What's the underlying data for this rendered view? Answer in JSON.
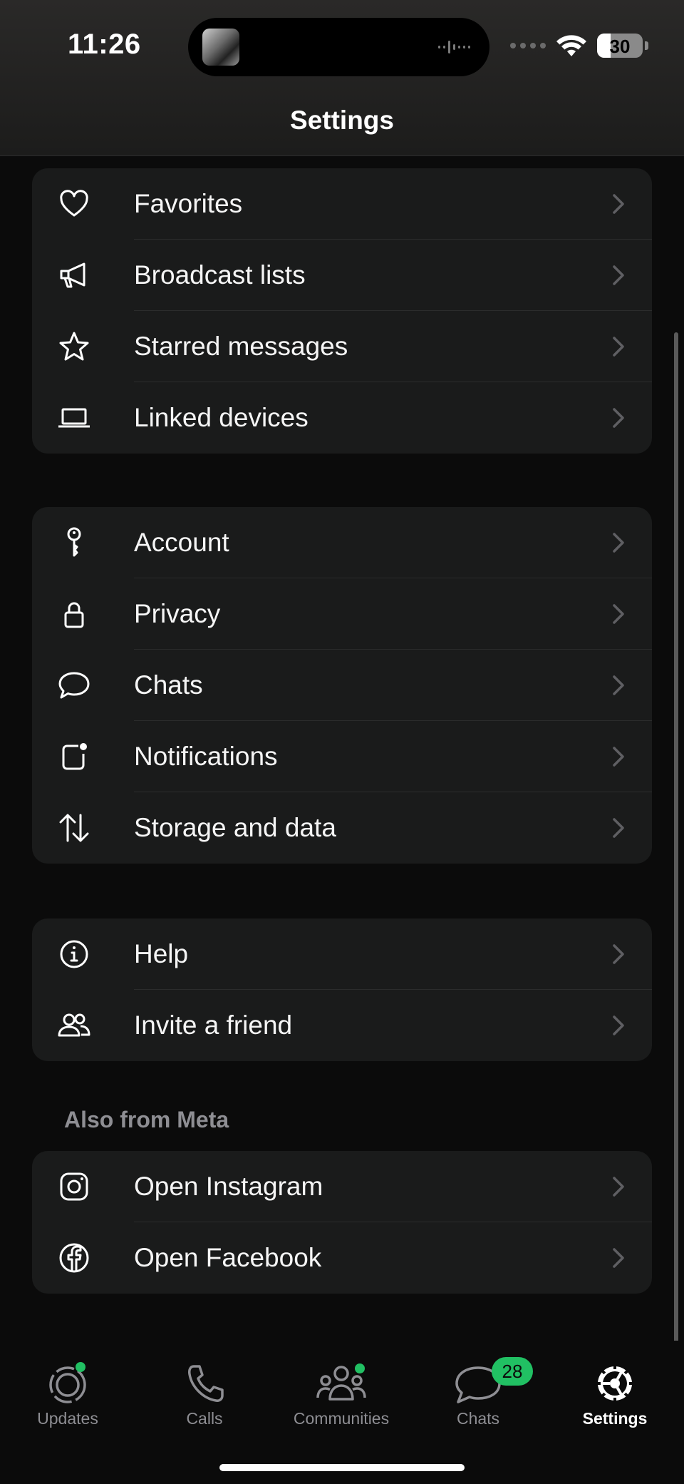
{
  "status_bar": {
    "time": "11:26",
    "battery_level": "30"
  },
  "header": {
    "title": "Settings"
  },
  "groups": [
    {
      "items": [
        {
          "label": "Favorites",
          "icon": "heart-icon"
        },
        {
          "label": "Broadcast lists",
          "icon": "megaphone-icon"
        },
        {
          "label": "Starred messages",
          "icon": "star-icon"
        },
        {
          "label": "Linked devices",
          "icon": "laptop-icon"
        }
      ]
    },
    {
      "items": [
        {
          "label": "Account",
          "icon": "key-icon"
        },
        {
          "label": "Privacy",
          "icon": "lock-icon"
        },
        {
          "label": "Chats",
          "icon": "chat-bubble-icon"
        },
        {
          "label": "Notifications",
          "icon": "notification-icon"
        },
        {
          "label": "Storage and data",
          "icon": "storage-arrows-icon"
        }
      ]
    },
    {
      "items": [
        {
          "label": "Help",
          "icon": "info-icon"
        },
        {
          "label": "Invite a friend",
          "icon": "people-icon"
        }
      ]
    },
    {
      "section_label": "Also from Meta",
      "items": [
        {
          "label": "Open Instagram",
          "icon": "instagram-icon"
        },
        {
          "label": "Open Facebook",
          "icon": "facebook-icon"
        }
      ]
    }
  ],
  "tabbar": {
    "tabs": [
      {
        "label": "Updates",
        "icon": "updates-icon"
      },
      {
        "label": "Calls",
        "icon": "phone-icon"
      },
      {
        "label": "Communities",
        "icon": "communities-icon"
      },
      {
        "label": "Chats",
        "icon": "chats-icon",
        "badge": "28"
      },
      {
        "label": "Settings",
        "icon": "settings-gear-icon",
        "active": true
      }
    ]
  },
  "colors": {
    "accent_green": "#21c063",
    "background": "#0b0b0b",
    "card": "#1a1b1b",
    "secondary_text": "#8e8e93"
  }
}
